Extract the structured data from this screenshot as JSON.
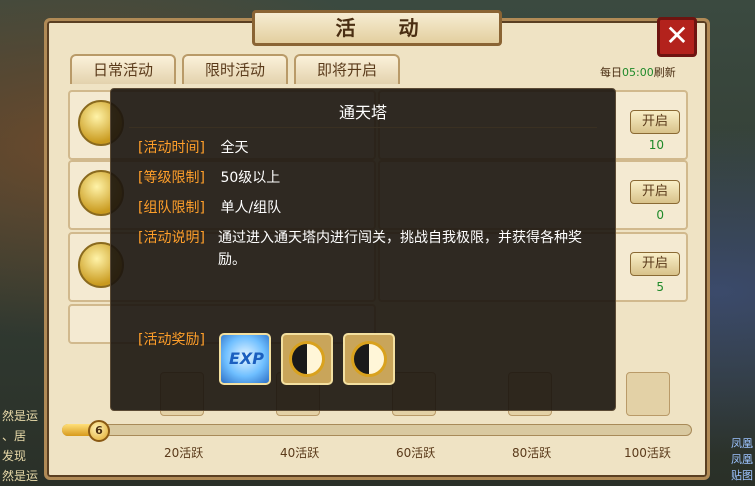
{
  "window": {
    "title": "活 动",
    "close_icon": "✕"
  },
  "tabs": [
    {
      "label": "日常活动"
    },
    {
      "label": "限时活动"
    },
    {
      "label": "即将开启"
    }
  ],
  "header": {
    "refresh_prefix": "每日",
    "refresh_time": "05:00",
    "refresh_suffix": "刷新"
  },
  "background_grid": [
    {
      "button": "开启",
      "extra": "10"
    },
    {
      "button": "开启",
      "extra": "0"
    },
    {
      "button": "开启",
      "extra": "5"
    }
  ],
  "progress": {
    "current": "6",
    "milestones": [
      "20活跃",
      "40活跃",
      "60活跃",
      "80活跃",
      "100活跃"
    ]
  },
  "dialog": {
    "title": "通天塔",
    "rows": [
      {
        "label": "[活动时间]",
        "value": "全天"
      },
      {
        "label": "[等级限制]",
        "value": "50级以上"
      },
      {
        "label": "[组队限制]",
        "value": "单人/组队"
      },
      {
        "label": "[活动说明]",
        "value": "通过进入通天塔内进行闯关，挑战自我极限，并获得各种奖励。"
      }
    ],
    "reward_label": "[活动奖励]",
    "rewards": [
      {
        "icon": "exp-icon",
        "text": "EXP"
      },
      {
        "icon": "yin-yang-icon"
      },
      {
        "icon": "yin-yang-icon"
      }
    ]
  },
  "side_text": {
    "left": [
      "然是运",
      "、居",
      "发现",
      "然是运"
    ],
    "right": [
      "凤凰",
      "凤凰",
      "贴图"
    ]
  },
  "colors": {
    "label_orange": "#ff9f2a",
    "refresh_green": "#1f8a2a",
    "close_red": "#b3221c"
  }
}
